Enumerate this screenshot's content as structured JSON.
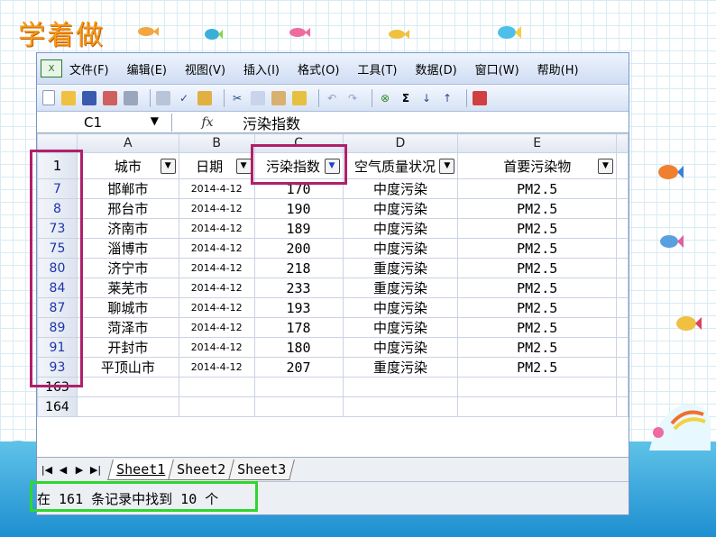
{
  "slide_title": "学着做",
  "colors": {
    "highlight_magenta": "#b0206a",
    "highlight_green": "#2fd62f",
    "title_orange": "#f29a1a"
  },
  "menu": {
    "app_icon": "excel-icon",
    "items": [
      "文件(F)",
      "编辑(E)",
      "视图(V)",
      "插入(I)",
      "格式(O)",
      "工具(T)",
      "数据(D)",
      "窗口(W)",
      "帮助(H)"
    ]
  },
  "toolbar": {
    "icons": [
      "new-icon",
      "open-icon",
      "save-icon",
      "permission-icon",
      "print-icon",
      "print-preview-icon",
      "spell-check-icon",
      "research-icon",
      "cut-icon",
      "copy-icon",
      "paste-icon",
      "format-painter-icon",
      "undo-icon",
      "redo-icon",
      "hyperlink-icon",
      "autosum-icon",
      "sort-ascending-icon",
      "sort-descending-icon",
      "chart-wizard-icon"
    ]
  },
  "formula_bar": {
    "name_box": "C1",
    "fx": "fx",
    "value": "污染指数"
  },
  "columns": [
    "A",
    "B",
    "C",
    "D",
    "E"
  ],
  "header_row": {
    "row_number": "1",
    "cells": [
      "城市",
      "日期",
      "污染指数",
      "空气质量状况",
      "首要污染物"
    ]
  },
  "rows": [
    {
      "n": "7",
      "city": "邯郸市",
      "date": "2014-4-12",
      "index": "170",
      "quality": "中度污染",
      "pollutant": "PM2.5"
    },
    {
      "n": "8",
      "city": "邢台市",
      "date": "2014-4-12",
      "index": "190",
      "quality": "中度污染",
      "pollutant": "PM2.5"
    },
    {
      "n": "73",
      "city": "济南市",
      "date": "2014-4-12",
      "index": "189",
      "quality": "中度污染",
      "pollutant": "PM2.5"
    },
    {
      "n": "75",
      "city": "淄博市",
      "date": "2014-4-12",
      "index": "200",
      "quality": "中度污染",
      "pollutant": "PM2.5"
    },
    {
      "n": "80",
      "city": "济宁市",
      "date": "2014-4-12",
      "index": "218",
      "quality": "重度污染",
      "pollutant": "PM2.5"
    },
    {
      "n": "84",
      "city": "莱芜市",
      "date": "2014-4-12",
      "index": "233",
      "quality": "重度污染",
      "pollutant": "PM2.5"
    },
    {
      "n": "87",
      "city": "聊城市",
      "date": "2014-4-12",
      "index": "193",
      "quality": "中度污染",
      "pollutant": "PM2.5"
    },
    {
      "n": "89",
      "city": "菏泽市",
      "date": "2014-4-12",
      "index": "178",
      "quality": "中度污染",
      "pollutant": "PM2.5"
    },
    {
      "n": "91",
      "city": "开封市",
      "date": "2014-4-12",
      "index": "180",
      "quality": "中度污染",
      "pollutant": "PM2.5"
    },
    {
      "n": "93",
      "city": "平顶山市",
      "date": "2014-4-12",
      "index": "207",
      "quality": "重度污染",
      "pollutant": "PM2.5"
    }
  ],
  "empty_rows": [
    "163",
    "164"
  ],
  "sheet_tabs": [
    "Sheet1",
    "Sheet2",
    "Sheet3"
  ],
  "status": "在 161 条记录中找到 10 个"
}
